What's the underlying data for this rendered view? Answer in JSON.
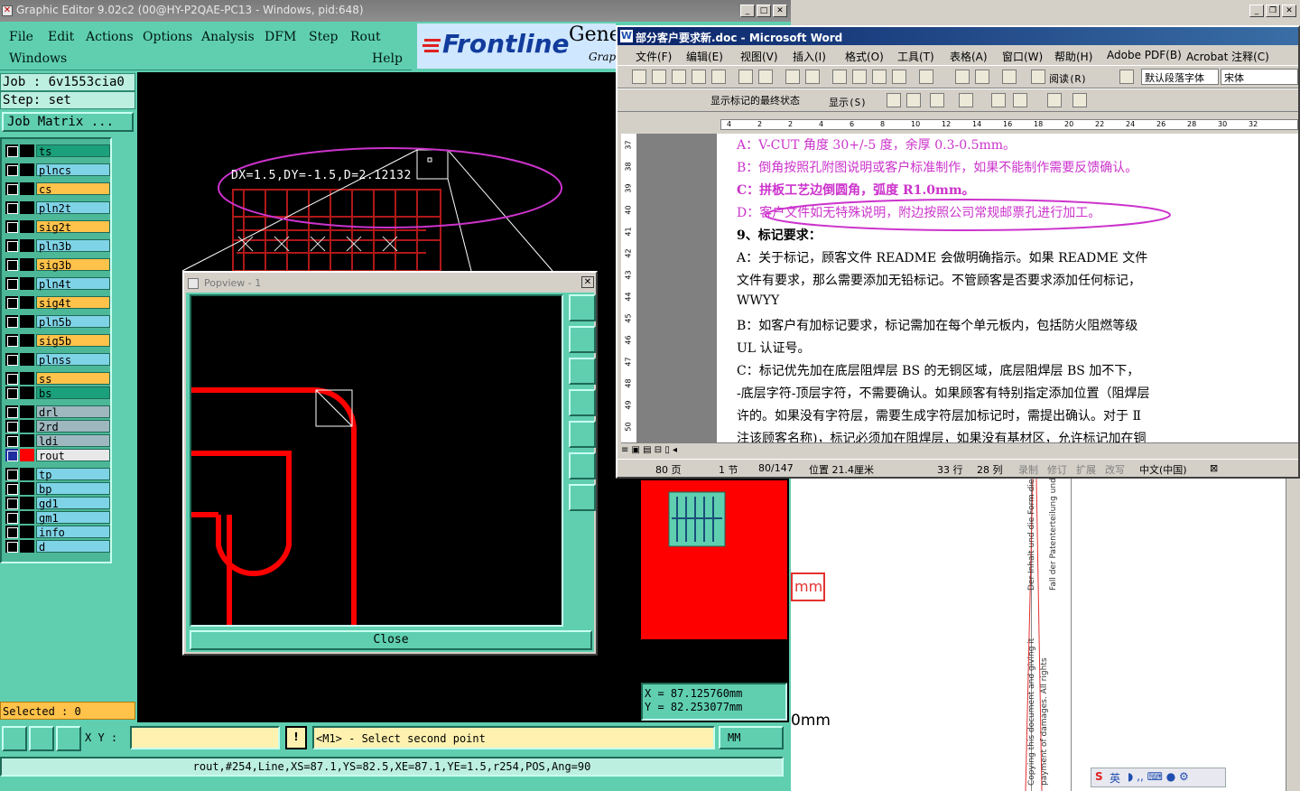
{
  "genesis": {
    "title": "Graphic Editor 9.02c2 (00@HY-P2QAE-PC13 - Windows, pid:648)",
    "menu": [
      "File",
      "Edit",
      "Actions",
      "Options",
      "Analysis",
      "DFM",
      "Step",
      "Rout"
    ],
    "menu_row2_left": "Windows",
    "menu_row2_right": "Help",
    "logo": "Frontline",
    "logo_side_text": "Gene",
    "logo_sub": "Grap",
    "job": "Job : 6v1553cia0",
    "step": "Step: set",
    "job_matrix_button": "Job Matrix ...",
    "layers": [
      {
        "name": "ts",
        "color": "#1aa07a",
        "switch": "#000000"
      },
      {
        "name": "plncs",
        "color": "#7fd3e6",
        "switch": "#000000"
      },
      {
        "name": "cs",
        "color": "#ffc24a",
        "switch": "#000000"
      },
      {
        "name": "pln2t",
        "color": "#7fd3e6",
        "switch": "#000000"
      },
      {
        "name": "sig2t",
        "color": "#ffc24a",
        "switch": "#000000"
      },
      {
        "name": "pln3b",
        "color": "#7fd3e6",
        "switch": "#000000"
      },
      {
        "name": "sig3b",
        "color": "#ffc24a",
        "switch": "#000000"
      },
      {
        "name": "pln4t",
        "color": "#7fd3e6",
        "switch": "#000000"
      },
      {
        "name": "sig4t",
        "color": "#ffc24a",
        "switch": "#000000"
      },
      {
        "name": "pln5b",
        "color": "#7fd3e6",
        "switch": "#000000"
      },
      {
        "name": "sig5b",
        "color": "#ffc24a",
        "switch": "#000000"
      },
      {
        "name": "plnss",
        "color": "#7fd3e6",
        "switch": "#000000"
      },
      {
        "name": "ss",
        "color": "#ffc24a",
        "switch": "#000000"
      },
      {
        "name": "bs",
        "color": "#1aa07a",
        "switch": "#000000"
      },
      {
        "name": "drl",
        "color": "#9fb8c0",
        "switch": "#000000"
      },
      {
        "name": "2rd",
        "color": "#9fb8c0",
        "switch": "#000000"
      },
      {
        "name": "ldi",
        "color": "#9fb8c0",
        "switch": "#000000"
      },
      {
        "name": "rout",
        "color": "#e8e8e8",
        "switch": "#ff0000",
        "active": true
      },
      {
        "name": "tp",
        "color": "#7fd3e6",
        "switch": "#000000"
      },
      {
        "name": "bp",
        "color": "#7fd3e6",
        "switch": "#000000"
      },
      {
        "name": "gd1",
        "color": "#7fd3e6",
        "switch": "#000000"
      },
      {
        "name": "gm1",
        "color": "#7fd3e6",
        "switch": "#000000"
      },
      {
        "name": "info",
        "color": "#7fd3e6",
        "switch": "#000000"
      },
      {
        "name": "d",
        "color": "#7fd3e6",
        "switch": "#000000"
      }
    ],
    "selected": "Selected : 0",
    "measure_readout": "DX=1.5,DY=-1.5,D=2.12132",
    "popview": {
      "title": "Popview - 1",
      "close_button": "Close"
    },
    "coords": {
      "x": "X  =  87.125760mm",
      "y": "Y  =  82.253077mm"
    },
    "xy_label": "X Y :",
    "xy_value": "",
    "prompt": "<M1> - Select second point",
    "units": "MM",
    "status": "rout,#254,Line,XS=87.1,YS=82.5,XE=87.1,YE=1.5,r254,POS,Ang=90"
  },
  "word": {
    "title": "部分客户要求新.doc - Microsoft Word",
    "menu": [
      "文件(F)",
      "编辑(E)",
      "视图(V)",
      "插入(I)",
      "格式(O)",
      "工具(T)",
      "表格(A)",
      "窗口(W)",
      "帮助(H)",
      "Adobe PDF(B)",
      "Acrobat 注释(C)"
    ],
    "read_button": "阅读(R)",
    "style_box": "默认段落字体",
    "font_box": "宋体",
    "markup_box": "显示标记的最终状态",
    "show_button": "显示(S)",
    "ruler_marks": [
      "4",
      "2",
      "2",
      "4",
      "6",
      "8",
      "10",
      "12",
      "14",
      "16",
      "18",
      "20",
      "22",
      "24",
      "26",
      "28",
      "30",
      "32"
    ],
    "vruler_marks": [
      "37",
      "38",
      "39",
      "40",
      "41",
      "42",
      "43",
      "44",
      "45",
      "46",
      "47",
      "48",
      "49",
      "50"
    ],
    "lines": [
      {
        "text": "A：V-CUT 角度 30+/-5 度，余厚 0.3-0.5mm。",
        "style": "pink"
      },
      {
        "text": "B：倒角按照孔附图说明或客户标准制作，如果不能制作需要反馈确认。",
        "style": "pink"
      },
      {
        "text": "C：拼板工艺边倒圆角，弧度 R1.0mm。",
        "style": "pink-bold"
      },
      {
        "text": "D：客户文件如无特殊说明，附边按照公司常规邮票孔进行加工。",
        "style": "pink"
      },
      {
        "text": "9、标记要求：",
        "style": "bold"
      },
      {
        "text": " A：关于标记，顾客文件 README 会做明确指示。如果 README 文件",
        "style": "normal"
      },
      {
        "text": "文件有要求，那么需要添加无铅标记。不管顾客是否要求添加任何标记，",
        "style": "normal"
      },
      {
        "text": "WWYY",
        "style": "normal"
      },
      {
        "text": " B：如客户有加标记要求，标记需加在每个单元板内，包括防火阻燃等级",
        "style": "normal"
      },
      {
        "text": "UL 认证号。",
        "style": "normal"
      },
      {
        "text": " C：标记优先加在底层阻焊层 BS 的无铜区域，底层阻焊层 BS 加不下，",
        "style": "normal"
      },
      {
        "text": "-底层字符-顶层字符，不需要确认。如果顾客有特别指定添加位置（阻焊层",
        "style": "normal"
      },
      {
        "text": "许的。如果没有字符层，需要生成字符层加标记时，需提出确认。对于 Ⅱ",
        "style": "normal"
      },
      {
        "text": "注该顾客名称)，标记必须加在阻焊层，如果没有基材区，允许标记加在铜",
        "style": "normal"
      }
    ],
    "status": {
      "page": "80 页",
      "section": "1 节",
      "pages": "80/147",
      "position": "位置 21.4厘米",
      "line": "33 行",
      "col": "28 列",
      "rec": "录制",
      "trk": "修订",
      "ext": "扩展",
      "ovr": "改写",
      "lang": "中文(中国)"
    }
  },
  "behind_doc": {
    "mm_label_1": "mm",
    "mm_label_2": "0mm",
    "rotated_1": "Der Inhalt und die Form dieses",
    "rotated_2": "Fall der Patenterteilung und/o",
    "rotated_3": "Copying this document and giving it",
    "rotated_4": "payment of damages. All rights"
  },
  "ime": {
    "label": "英"
  },
  "colors": {
    "teal": "#5fcfb0",
    "red": "#ff0000",
    "magenta": "#cc33cc",
    "word_blue": "#0a246a"
  }
}
